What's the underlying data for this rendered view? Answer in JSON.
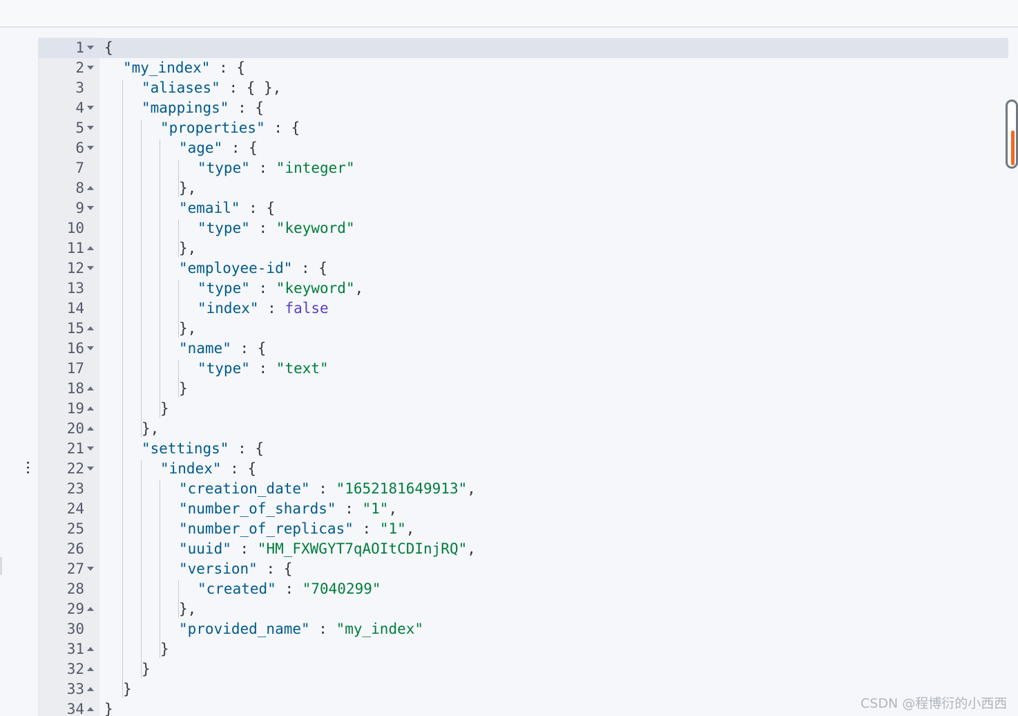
{
  "colors": {
    "key": "#005a8c",
    "string": "#017d3b",
    "boolean": "#5c3ec4",
    "punctuation": "#343741",
    "line_number": "#535966",
    "active_line": "#dfe3eb",
    "scroll_marker": "#f06a20"
  },
  "icons": {
    "fold_open": "triangle-down-icon",
    "fold_closed": "triangle-up-icon",
    "drag_handle": "vertical-dots-icon"
  },
  "editor": {
    "lines": [
      {
        "number": "1",
        "fold": "open",
        "tokens": [
          {
            "t": "punc",
            "v": "{"
          }
        ]
      },
      {
        "number": "2",
        "fold": "open",
        "tokens": [
          {
            "t": "key",
            "v": "\"my_index\""
          },
          {
            "t": "punc",
            "v": " : {"
          }
        ]
      },
      {
        "number": "3",
        "fold": "",
        "tokens": [
          {
            "t": "key",
            "v": "\"aliases\""
          },
          {
            "t": "punc",
            "v": " : { },"
          }
        ]
      },
      {
        "number": "4",
        "fold": "open",
        "tokens": [
          {
            "t": "key",
            "v": "\"mappings\""
          },
          {
            "t": "punc",
            "v": " : {"
          }
        ]
      },
      {
        "number": "5",
        "fold": "open",
        "tokens": [
          {
            "t": "key",
            "v": "\"properties\""
          },
          {
            "t": "punc",
            "v": " : {"
          }
        ]
      },
      {
        "number": "6",
        "fold": "open",
        "tokens": [
          {
            "t": "key",
            "v": "\"age\""
          },
          {
            "t": "punc",
            "v": " : {"
          }
        ]
      },
      {
        "number": "7",
        "fold": "",
        "tokens": [
          {
            "t": "key",
            "v": "\"type\""
          },
          {
            "t": "punc",
            "v": " : "
          },
          {
            "t": "str",
            "v": "\"integer\""
          }
        ]
      },
      {
        "number": "8",
        "fold": "close",
        "tokens": [
          {
            "t": "punc",
            "v": "},"
          }
        ]
      },
      {
        "number": "9",
        "fold": "open",
        "tokens": [
          {
            "t": "key",
            "v": "\"email\""
          },
          {
            "t": "punc",
            "v": " : {"
          }
        ]
      },
      {
        "number": "10",
        "fold": "",
        "tokens": [
          {
            "t": "key",
            "v": "\"type\""
          },
          {
            "t": "punc",
            "v": " : "
          },
          {
            "t": "str",
            "v": "\"keyword\""
          }
        ]
      },
      {
        "number": "11",
        "fold": "close",
        "tokens": [
          {
            "t": "punc",
            "v": "},"
          }
        ]
      },
      {
        "number": "12",
        "fold": "open",
        "tokens": [
          {
            "t": "key",
            "v": "\"employee-id\""
          },
          {
            "t": "punc",
            "v": " : {"
          }
        ]
      },
      {
        "number": "13",
        "fold": "",
        "tokens": [
          {
            "t": "key",
            "v": "\"type\""
          },
          {
            "t": "punc",
            "v": " : "
          },
          {
            "t": "str",
            "v": "\"keyword\""
          },
          {
            "t": "punc",
            "v": ","
          }
        ]
      },
      {
        "number": "14",
        "fold": "",
        "tokens": [
          {
            "t": "key",
            "v": "\"index\""
          },
          {
            "t": "punc",
            "v": " : "
          },
          {
            "t": "bool",
            "v": "false"
          }
        ]
      },
      {
        "number": "15",
        "fold": "close",
        "tokens": [
          {
            "t": "punc",
            "v": "},"
          }
        ]
      },
      {
        "number": "16",
        "fold": "open",
        "tokens": [
          {
            "t": "key",
            "v": "\"name\""
          },
          {
            "t": "punc",
            "v": " : {"
          }
        ]
      },
      {
        "number": "17",
        "fold": "",
        "tokens": [
          {
            "t": "key",
            "v": "\"type\""
          },
          {
            "t": "punc",
            "v": " : "
          },
          {
            "t": "str",
            "v": "\"text\""
          }
        ]
      },
      {
        "number": "18",
        "fold": "close",
        "tokens": [
          {
            "t": "punc",
            "v": "}"
          }
        ]
      },
      {
        "number": "19",
        "fold": "close",
        "tokens": [
          {
            "t": "punc",
            "v": "}"
          }
        ]
      },
      {
        "number": "20",
        "fold": "close",
        "tokens": [
          {
            "t": "punc",
            "v": "},"
          }
        ]
      },
      {
        "number": "21",
        "fold": "open",
        "tokens": [
          {
            "t": "key",
            "v": "\"settings\""
          },
          {
            "t": "punc",
            "v": " : {"
          }
        ]
      },
      {
        "number": "22",
        "fold": "open",
        "tokens": [
          {
            "t": "key",
            "v": "\"index\""
          },
          {
            "t": "punc",
            "v": " : {"
          }
        ]
      },
      {
        "number": "23",
        "fold": "",
        "tokens": [
          {
            "t": "key",
            "v": "\"creation_date\""
          },
          {
            "t": "punc",
            "v": " : "
          },
          {
            "t": "str",
            "v": "\"1652181649913\""
          },
          {
            "t": "punc",
            "v": ","
          }
        ]
      },
      {
        "number": "24",
        "fold": "",
        "tokens": [
          {
            "t": "key",
            "v": "\"number_of_shards\""
          },
          {
            "t": "punc",
            "v": " : "
          },
          {
            "t": "str",
            "v": "\"1\""
          },
          {
            "t": "punc",
            "v": ","
          }
        ]
      },
      {
        "number": "25",
        "fold": "",
        "tokens": [
          {
            "t": "key",
            "v": "\"number_of_replicas\""
          },
          {
            "t": "punc",
            "v": " : "
          },
          {
            "t": "str",
            "v": "\"1\""
          },
          {
            "t": "punc",
            "v": ","
          }
        ]
      },
      {
        "number": "26",
        "fold": "",
        "tokens": [
          {
            "t": "key",
            "v": "\"uuid\""
          },
          {
            "t": "punc",
            "v": " : "
          },
          {
            "t": "str",
            "v": "\"HM_FXWGYT7qAOItCDInjRQ\""
          },
          {
            "t": "punc",
            "v": ","
          }
        ]
      },
      {
        "number": "27",
        "fold": "open",
        "tokens": [
          {
            "t": "key",
            "v": "\"version\""
          },
          {
            "t": "punc",
            "v": " : {"
          }
        ]
      },
      {
        "number": "28",
        "fold": "",
        "tokens": [
          {
            "t": "key",
            "v": "\"created\""
          },
          {
            "t": "punc",
            "v": " : "
          },
          {
            "t": "str",
            "v": "\"7040299\""
          }
        ]
      },
      {
        "number": "29",
        "fold": "close",
        "tokens": [
          {
            "t": "punc",
            "v": "},"
          }
        ]
      },
      {
        "number": "30",
        "fold": "",
        "tokens": [
          {
            "t": "key",
            "v": "\"provided_name\""
          },
          {
            "t": "punc",
            "v": " : "
          },
          {
            "t": "str",
            "v": "\"my_index\""
          }
        ]
      },
      {
        "number": "31",
        "fold": "close",
        "tokens": [
          {
            "t": "punc",
            "v": "}"
          }
        ]
      },
      {
        "number": "32",
        "fold": "close",
        "tokens": [
          {
            "t": "punc",
            "v": "}"
          }
        ]
      },
      {
        "number": "33",
        "fold": "close",
        "tokens": [
          {
            "t": "punc",
            "v": "}"
          }
        ]
      },
      {
        "number": "34",
        "fold": "close",
        "tokens": [
          {
            "t": "punc",
            "v": "}"
          }
        ]
      }
    ]
  },
  "watermark": {
    "text": "CSDN @程博衍的小西西"
  }
}
